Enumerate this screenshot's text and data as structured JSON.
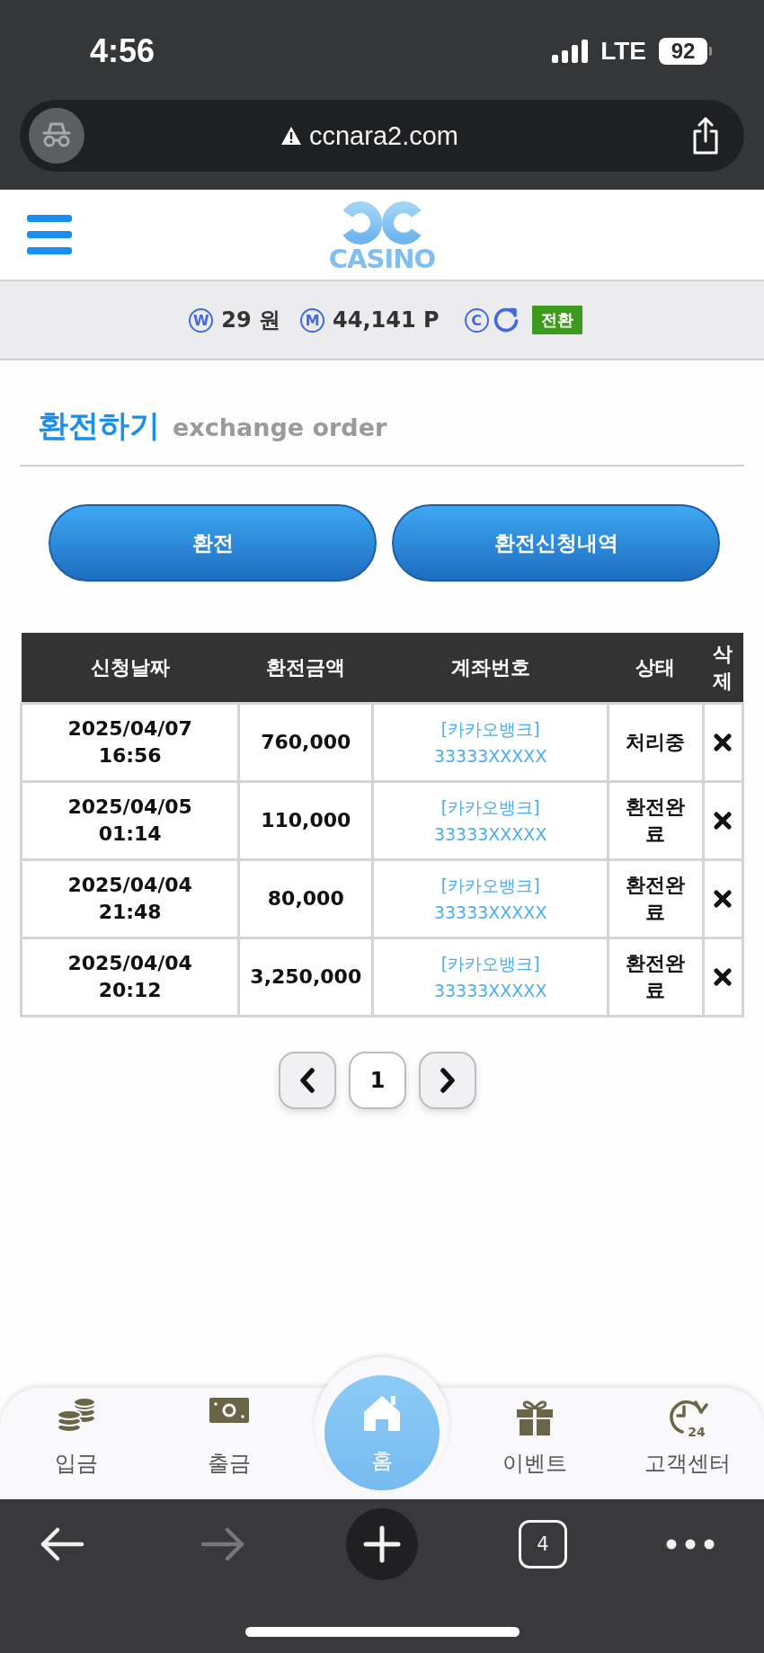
{
  "status_bar": {
    "time": "4:56",
    "network": "LTE",
    "battery": "92"
  },
  "address_bar": {
    "url": "ccnara2.com"
  },
  "header": {
    "logo_text": "CASINO"
  },
  "balance": {
    "items": [
      {
        "symbol": "W",
        "value": "29 원"
      },
      {
        "symbol": "M",
        "value": "44,141 P"
      }
    ],
    "coupon": {
      "symbol": "C"
    },
    "convert_button": "전환"
  },
  "page_title": {
    "title": "환전하기",
    "subtitle": "exchange order"
  },
  "actions": [
    "환전",
    "환전신청내역"
  ],
  "table": {
    "columns": [
      "신청날짜",
      "환전금액",
      "계좌번호",
      "상태",
      "삭제"
    ],
    "rows": [
      {
        "date": "2025/04/07",
        "time": "16:56",
        "amount": "760,000",
        "bank": "[카카오뱅크]",
        "account": "33333XXXXX",
        "status": "처리중"
      },
      {
        "date": "2025/04/05",
        "time": "01:14",
        "amount": "110,000",
        "bank": "[카카오뱅크]",
        "account": "33333XXXXX",
        "status": "환전완료"
      },
      {
        "date": "2025/04/04",
        "time": "21:48",
        "amount": "80,000",
        "bank": "[카카오뱅크]",
        "account": "33333XXXXX",
        "status": "환전완료"
      },
      {
        "date": "2025/04/04",
        "time": "20:12",
        "amount": "3,250,000",
        "bank": "[카카오뱅크]",
        "account": "33333XXXXX",
        "status": "환전완료"
      }
    ]
  },
  "pagination": {
    "pages": [
      {
        "label": "1",
        "selected": true
      }
    ]
  },
  "bottom_nav": {
    "items": [
      {
        "label": "입금",
        "kind": "tab"
      },
      {
        "label": "출금",
        "kind": "tab"
      },
      {
        "label": "홈",
        "kind": "center"
      },
      {
        "label": "이벤트",
        "kind": "tab"
      },
      {
        "label": "고객센터",
        "kind": "tab",
        "icon_text": "24"
      }
    ]
  },
  "browser_toolbar": {
    "back": {
      "disabled": false
    },
    "forward": {
      "disabled": true
    },
    "tab_count": "4"
  }
}
